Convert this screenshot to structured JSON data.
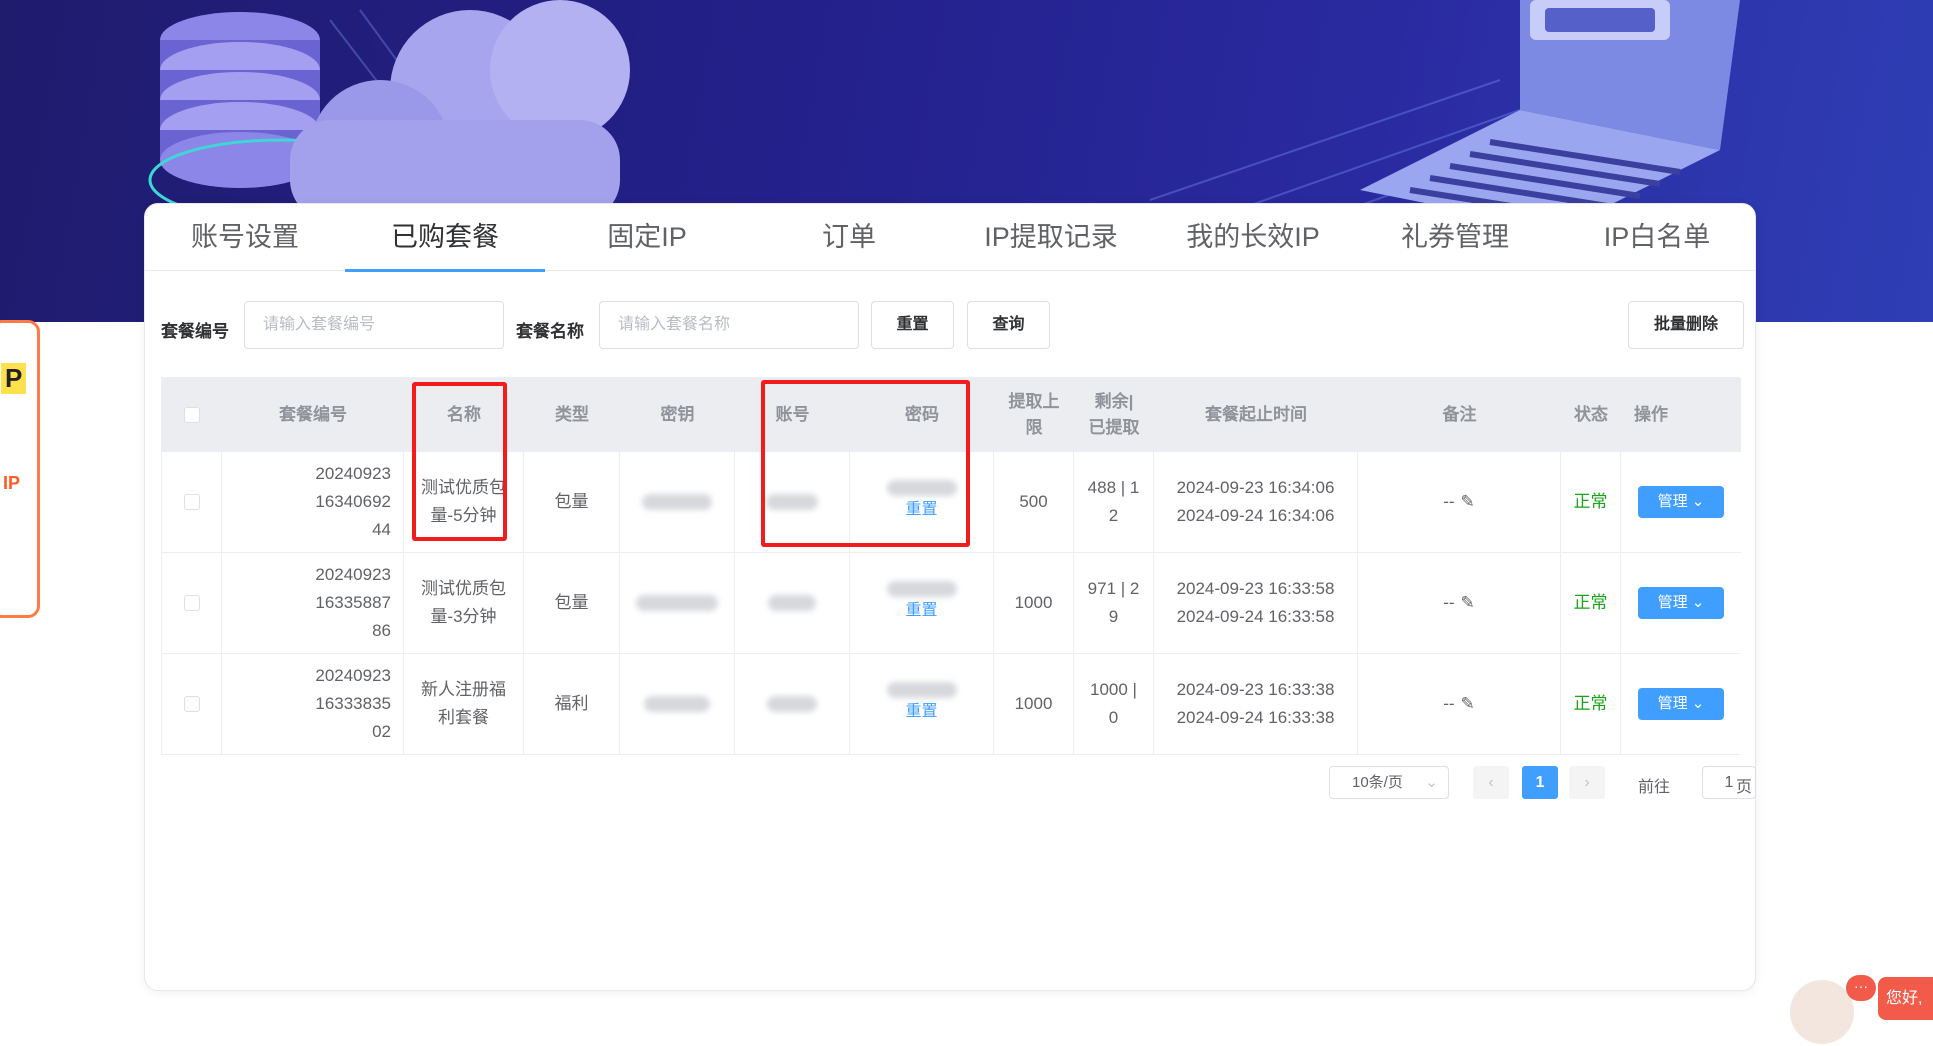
{
  "tabs": [
    {
      "label": "账号设置"
    },
    {
      "label": "已购套餐"
    },
    {
      "label": "固定IP"
    },
    {
      "label": "订单"
    },
    {
      "label": "IP提取记录"
    },
    {
      "label": "我的长效IP"
    },
    {
      "label": "礼券管理"
    },
    {
      "label": "IP白名单"
    }
  ],
  "side_promo": {
    "p": "P",
    "dip": "IP"
  },
  "search": {
    "id_label": "套餐编号",
    "id_placeholder": "请输入套餐编号",
    "name_label": "套餐名称",
    "name_placeholder": "请输入套餐名称",
    "reset_label": "重置",
    "query_label": "查询",
    "batch_delete_label": "批量删除"
  },
  "table": {
    "headers": {
      "id": "套餐编号",
      "name": "名称",
      "type": "类型",
      "key": "密钥",
      "account": "账号",
      "password": "密码",
      "limit": "提取上限",
      "remain": "剩余|已提取",
      "time": "套餐起止时间",
      "note": "备注",
      "status": "状态",
      "ops": "操作"
    },
    "rows": [
      {
        "id_lines": [
          "20240923",
          "16340692",
          "44"
        ],
        "name_lines": [
          "测试优质包",
          "量-5分钟"
        ],
        "type": "包量",
        "reset_link": "重置",
        "limit": "500",
        "remain_lines": [
          "488 | 1",
          "2"
        ],
        "start": "2024-09-23 16:34:06",
        "end": "2024-09-24 16:34:06",
        "note": "--",
        "status": "正常",
        "manage": "管理"
      },
      {
        "id_lines": [
          "20240923",
          "16335887",
          "86"
        ],
        "name_lines": [
          "测试优质包",
          "量-3分钟"
        ],
        "type": "包量",
        "reset_link": "重置",
        "limit": "1000",
        "remain_lines": [
          "971 | 2",
          "9"
        ],
        "start": "2024-09-23 16:33:58",
        "end": "2024-09-24 16:33:58",
        "note": "--",
        "status": "正常",
        "manage": "管理"
      },
      {
        "id_lines": [
          "20240923",
          "16333835",
          "02"
        ],
        "name_lines": [
          "新人注册福",
          "利套餐"
        ],
        "type": "福利",
        "reset_link": "重置",
        "limit": "1000",
        "remain_lines": [
          "1000 |",
          "0"
        ],
        "start": "2024-09-23 16:33:38",
        "end": "2024-09-24 16:33:38",
        "note": "--",
        "status": "正常",
        "manage": "管理"
      }
    ]
  },
  "pagination": {
    "page_size": "10条/页",
    "current_page": "1",
    "goto_label": "前往",
    "goto_value": "1",
    "page_suffix": "页"
  },
  "chat": {
    "bubble": "···",
    "hello": "您好,"
  },
  "colors": {
    "accent": "#409eff",
    "status_ok": "#18a318",
    "highlight_box": "#f21c1c",
    "hero": "#23208a"
  }
}
